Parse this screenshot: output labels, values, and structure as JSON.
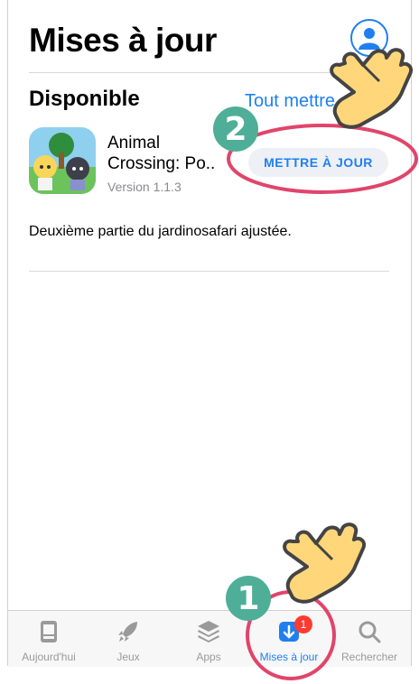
{
  "header": {
    "title": "Mises à jour"
  },
  "section": {
    "title": "Disponible",
    "update_all_label": "Tout mettre"
  },
  "app": {
    "name": "Animal Crossing: Po..",
    "version": "Version 1.1.3",
    "update_label": "METTRE À JOUR",
    "release_notes": "Deuxième partie du jardinosafari ajustée."
  },
  "tabbar": {
    "tabs": [
      {
        "label": "Aujourd'hui",
        "icon": "today-icon"
      },
      {
        "label": "Jeux",
        "icon": "rocket-icon"
      },
      {
        "label": "Apps",
        "icon": "layers-icon"
      },
      {
        "label": "Mises à jour",
        "icon": "download-icon",
        "active": true,
        "badge": "1"
      },
      {
        "label": "Rechercher",
        "icon": "search-icon"
      }
    ]
  },
  "annotations": {
    "step1": "1",
    "step2": "2"
  },
  "colors": {
    "accent": "#1f7ff0",
    "annotation_ring": "#e0456a",
    "step_badge": "#4fae98",
    "pointer_hand": "#ffd77a"
  }
}
